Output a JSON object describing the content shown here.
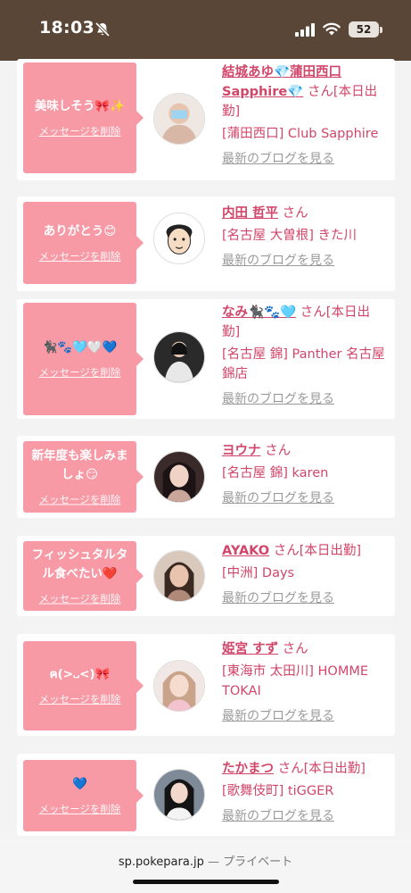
{
  "status": {
    "time": "18:03",
    "battery": "52"
  },
  "messages": [
    {
      "text": "美味しそう🎀✨",
      "delete_label": "メッセージを削除",
      "name": "結城あゆ💎蒲田西口Sapphire💎",
      "san": "さん[本日出勤]",
      "shop": "[蒲田西口] Club Sapphire",
      "blog": "最新のブログを見る"
    },
    {
      "text": "ありがとう😊",
      "delete_label": "メッセージを削除",
      "name": "内田 哲平",
      "san": "さん",
      "shop": "[名古屋 大曽根] きた川",
      "blog": "最新のブログを見る"
    },
    {
      "text": "🐈‍⬛🐾🩵🤍💙",
      "delete_label": "メッセージを削除",
      "name": "なみ🐈‍⬛🐾🩵",
      "san": "さん[本日出勤]",
      "shop": "[名古屋 錦] Panther 名古屋錦店",
      "blog": "最新のブログを見る"
    },
    {
      "text": "新年度も楽しみましょ😏",
      "delete_label": "メッセージを削除",
      "name": "ヨウナ",
      "san": "さん",
      "shop": "[名古屋 錦] karen",
      "blog": "最新のブログを見る"
    },
    {
      "text": "フィッシュタルタル食べたい❤️",
      "delete_label": "メッセージを削除",
      "name": "AYAKO",
      "san": "さん[本日出勤]",
      "shop": "[中洲] Days",
      "blog": "最新のブログを見る"
    },
    {
      "text": "ฅ(>᎑<)🎀",
      "delete_label": "メッセージを削除",
      "name": "姫宮 すず",
      "san": "さん",
      "shop": "[東海市 太田川] HOMME TOKAI",
      "blog": "最新のブログを見る"
    },
    {
      "text": "💙",
      "delete_label": "メッセージを削除",
      "name": "たかまつ",
      "san": "さん[本日出勤]",
      "shop": "[歌舞伎町] tiGGER",
      "blog": "最新のブログを見る"
    }
  ],
  "browser": {
    "domain": "sp.pokepara.jp",
    "separator": "—",
    "mode": "プライベート"
  },
  "colors": {
    "status_bar": "#5a4636",
    "bubble": "#f79aa6",
    "name_pink": "#d2466a",
    "blog_gray": "#9a9a9a"
  }
}
